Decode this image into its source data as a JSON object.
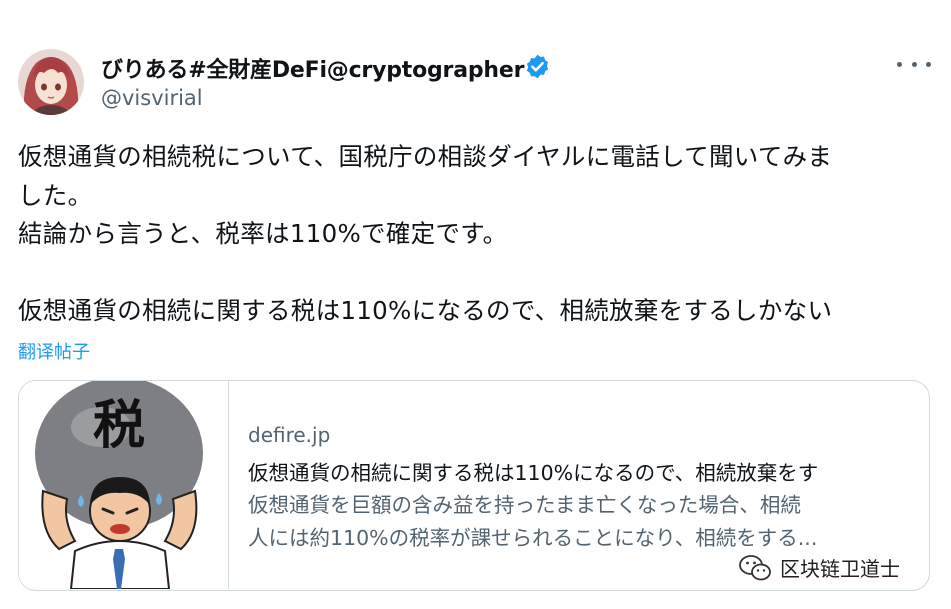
{
  "tweet": {
    "author": {
      "display_name": "びりある#全財産DeFi@cryptographer",
      "handle": "@visvirial",
      "verified": true,
      "avatar_icon": "anime-avatar-red-hair"
    },
    "more_icon": "more-horizontal-icon",
    "text_lines": [
      "仮想通貨の相続税について、国税庁の相談ダイヤルに電話して聞いてみま",
      "した。",
      "結論から言うと、税率は110%で確定です。",
      "",
      "仮想通貨の相続に関する税は110%になるので、相続放棄をするしかない"
    ],
    "translate_label": "翻译帖子"
  },
  "card": {
    "image_label": "税",
    "domain": "defire.jp",
    "title": "仮想通貨の相続に関する税は110%になるので、相続放棄をす",
    "description_lines": [
      "仮想通貨を巨額の含み益を持ったまま亡くなった場合、相続",
      "人には約110%の税率が課せられることになり、相続をする..."
    ]
  },
  "watermark": {
    "text": "区块链卫道士",
    "icon": "wechat-icon"
  },
  "colors": {
    "text": "#0f1419",
    "secondary": "#536471",
    "accent": "#1d9bf0",
    "border": "#cfd9de"
  }
}
